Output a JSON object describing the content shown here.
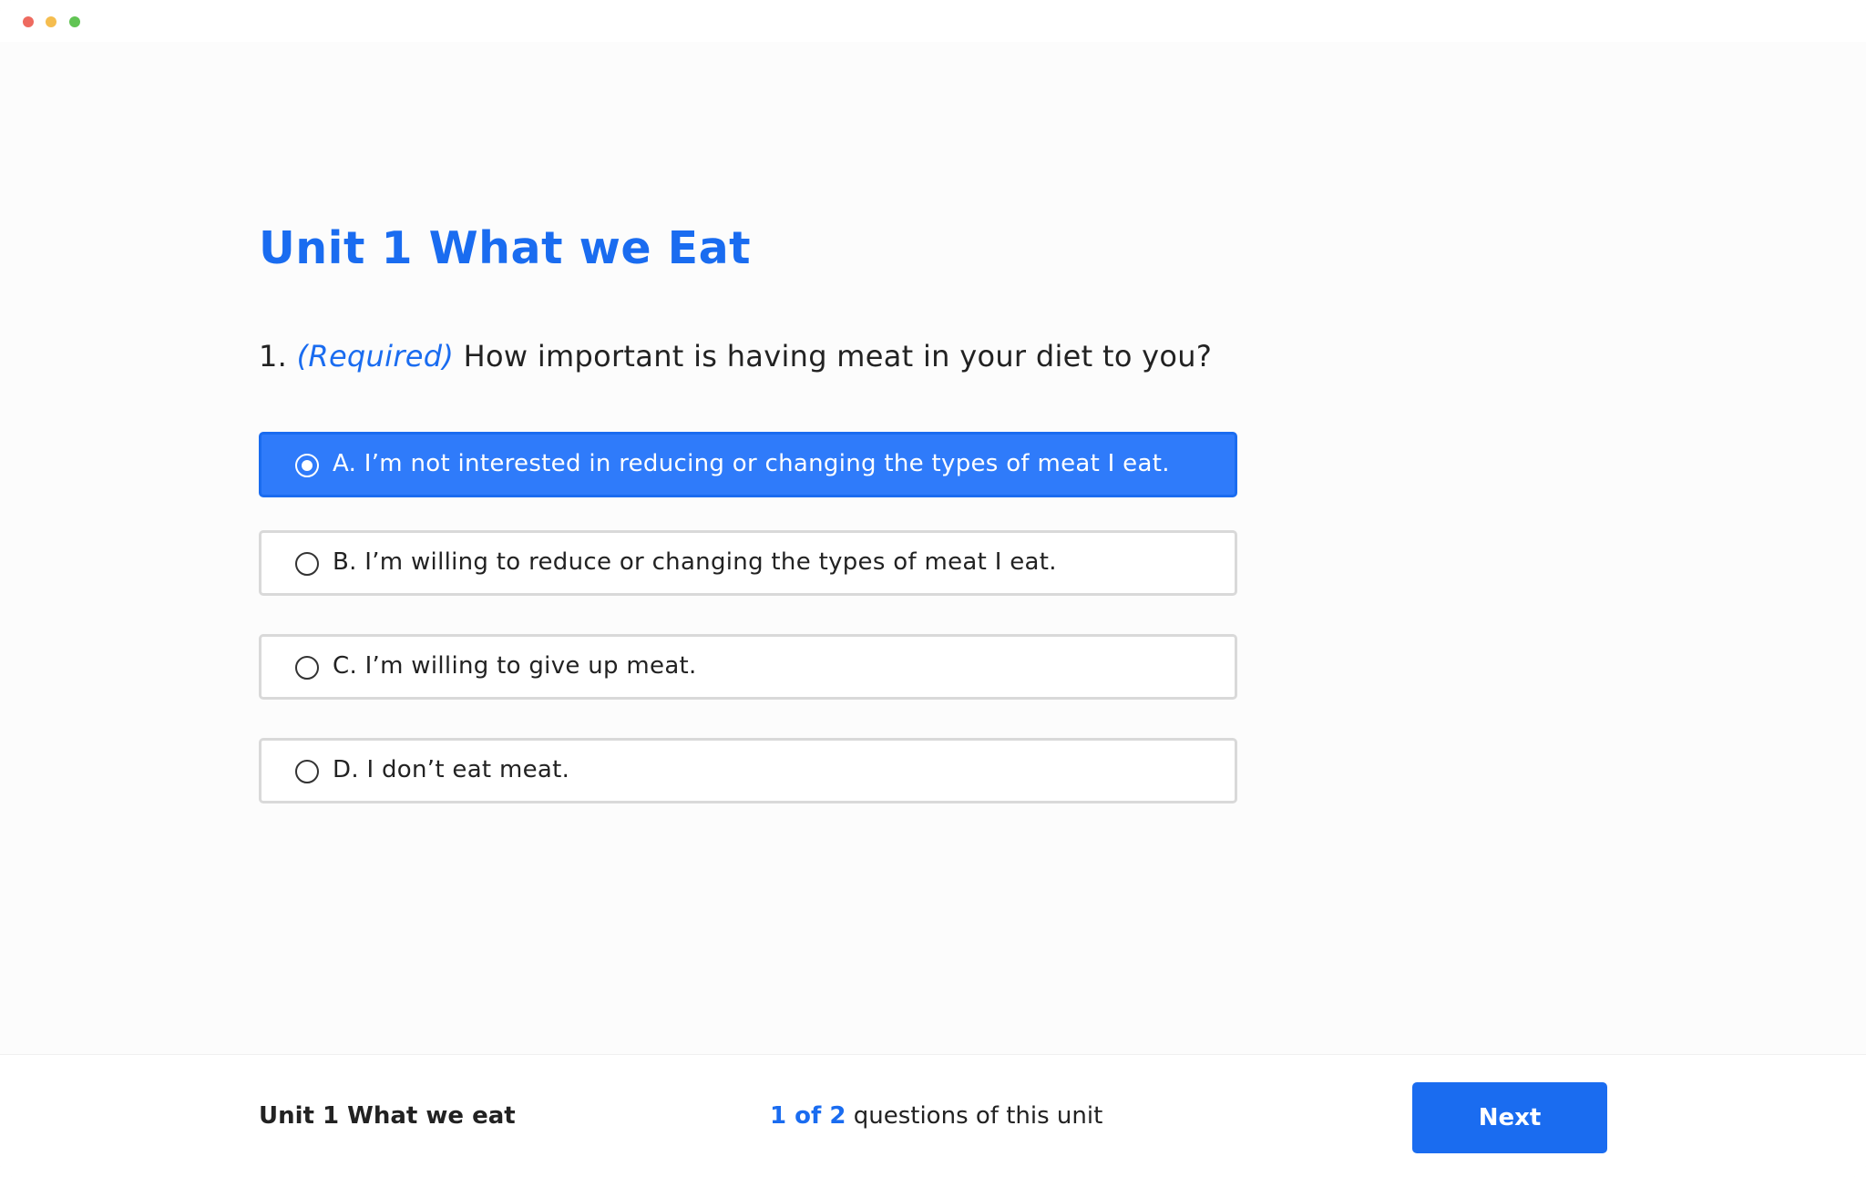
{
  "colors": {
    "accent": "#1a6cf0",
    "selected_fill": "#2f7bfa",
    "traffic_red": "#ee6a5f",
    "traffic_yellow": "#f5bd4f",
    "traffic_green": "#61c454"
  },
  "window": {
    "controls": [
      "close",
      "minimize",
      "maximize"
    ]
  },
  "header": {
    "unit_title": "Unit 1 What we Eat"
  },
  "question": {
    "number": "1.",
    "required_label": "(Required)",
    "text": "How important is having meat in your diet to you?"
  },
  "options": [
    {
      "label": "A. I’m not interested in reducing or changing the types of meat I eat.",
      "selected": true
    },
    {
      "label": "B. I’m willing to reduce or changing the types of meat I eat.",
      "selected": false
    },
    {
      "label": "C. I’m willing to give up meat.",
      "selected": false
    },
    {
      "label": "D. I don’t eat meat.",
      "selected": false
    }
  ],
  "footer": {
    "unit_name": "Unit 1 What we eat",
    "progress_count": "1 of 2",
    "progress_suffix": "questions of this unit",
    "next_label": "Next"
  }
}
